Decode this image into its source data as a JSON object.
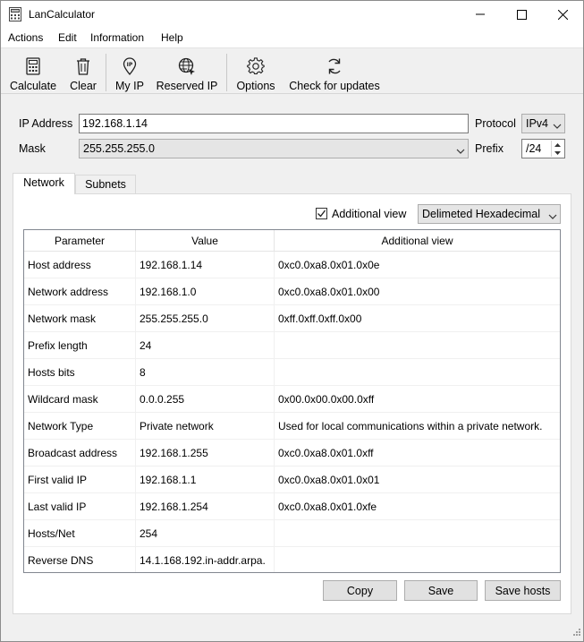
{
  "window": {
    "title": "LanCalculator"
  },
  "menu": {
    "items": [
      "Actions",
      "Edit",
      "Information",
      "Help"
    ]
  },
  "toolbar": {
    "calculate": "Calculate",
    "clear": "Clear",
    "my_ip": "My IP",
    "reserved_ip": "Reserved IP",
    "options": "Options",
    "check_updates": "Check for updates"
  },
  "form": {
    "ip_label": "IP Address",
    "ip_value": "192.168.1.14",
    "protocol_label": "Protocol",
    "protocol_value": "IPv4",
    "mask_label": "Mask",
    "mask_value": "255.255.255.0",
    "prefix_label": "Prefix",
    "prefix_value": "/24"
  },
  "tabs": {
    "network": "Network",
    "subnets": "Subnets",
    "active": "Network"
  },
  "view": {
    "additional_label": "Additional view",
    "additional_checked": true,
    "format_value": "Delimeted Hexadecimal"
  },
  "table": {
    "headers": [
      "Parameter",
      "Value",
      "Additional view"
    ],
    "rows": [
      [
        "Host address",
        "192.168.1.14",
        "0xc0.0xa8.0x01.0x0e"
      ],
      [
        "Network address",
        "192.168.1.0",
        "0xc0.0xa8.0x01.0x00"
      ],
      [
        "Network mask",
        "255.255.255.0",
        "0xff.0xff.0xff.0x00"
      ],
      [
        "Prefix length",
        "24",
        ""
      ],
      [
        "Hosts bits",
        "8",
        ""
      ],
      [
        "Wildcard mask",
        "0.0.0.255",
        "0x00.0x00.0x00.0xff"
      ],
      [
        "Network Type",
        "Private network",
        "Used for local communications within a private network."
      ],
      [
        "Broadcast address",
        "192.168.1.255",
        "0xc0.0xa8.0x01.0xff"
      ],
      [
        "First valid IP",
        "192.168.1.1",
        "0xc0.0xa8.0x01.0x01"
      ],
      [
        "Last valid IP",
        "192.168.1.254",
        "0xc0.0xa8.0x01.0xfe"
      ],
      [
        "Hosts/Net",
        "254",
        ""
      ],
      [
        "Reverse DNS",
        "14.1.168.192.in-addr.arpa.",
        ""
      ]
    ]
  },
  "buttons": {
    "copy": "Copy",
    "save": "Save",
    "save_hosts": "Save hosts"
  }
}
